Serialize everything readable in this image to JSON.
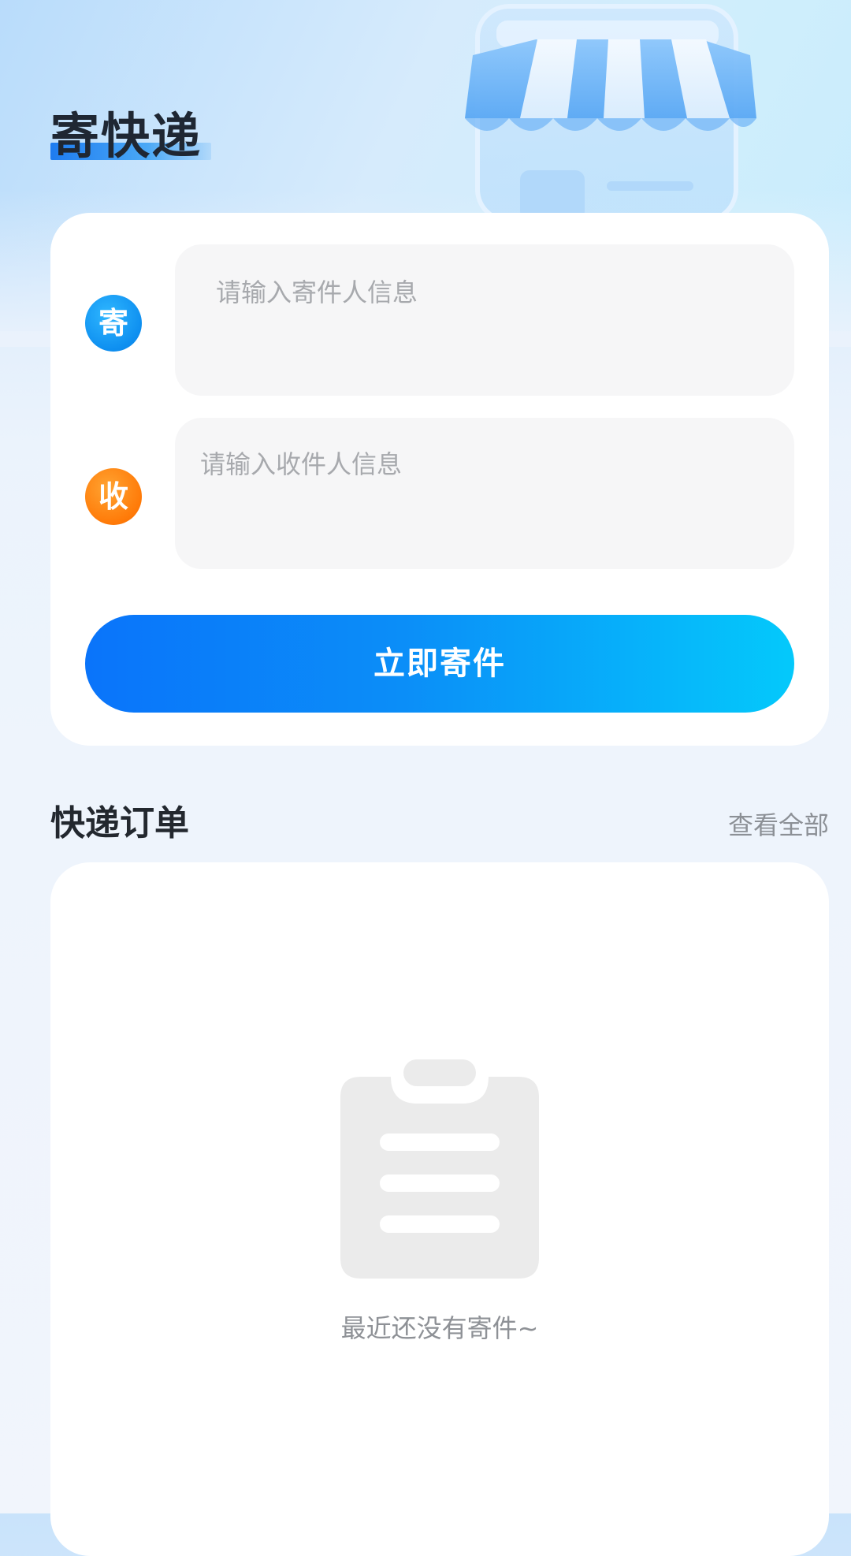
{
  "header": {
    "title": "寄快递"
  },
  "send_form": {
    "sender_badge": "寄",
    "sender_placeholder": "请输入寄件人信息",
    "receiver_badge": "收",
    "receiver_placeholder": "请输入收件人信息",
    "submit_label": "立即寄件"
  },
  "orders": {
    "title": "快递订单",
    "view_all_label": "查看全部",
    "empty_message": "最近还没有寄件~"
  },
  "icons": {
    "hero": "storefront-icon",
    "empty": "clipboard-icon"
  },
  "colors": {
    "primary": "#0a74fa",
    "primary_end": "#04c9fb",
    "sender_badge": "#0e8ff0",
    "receiver_badge": "#ff7a08"
  }
}
